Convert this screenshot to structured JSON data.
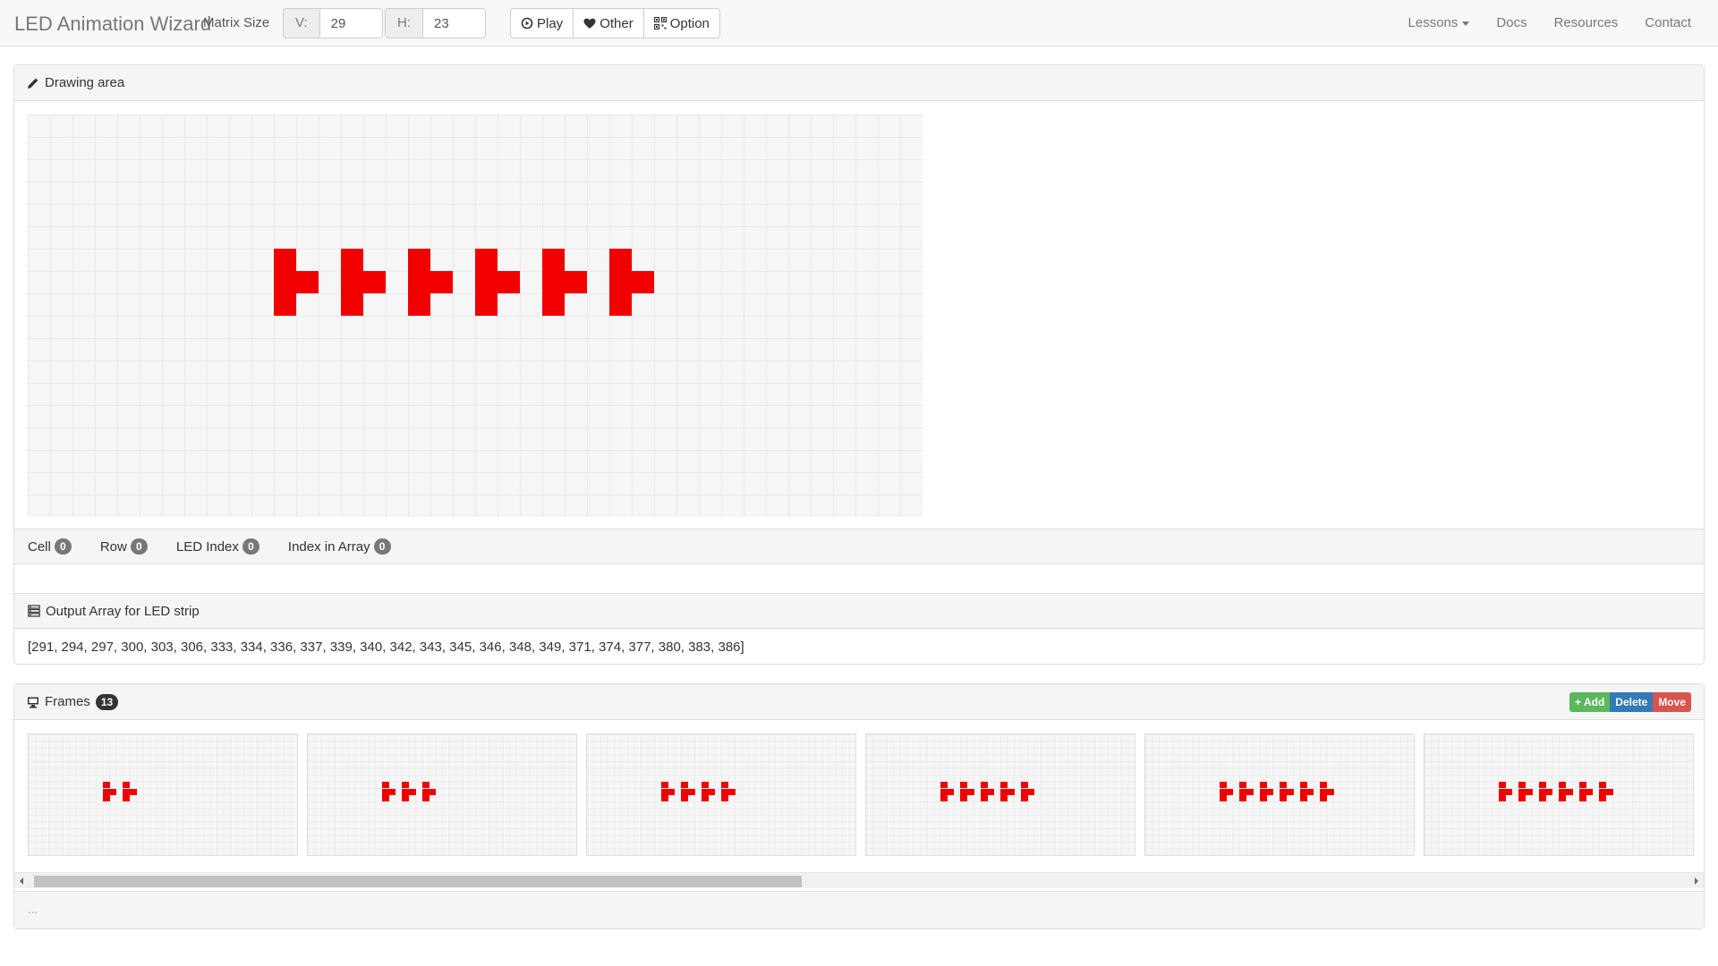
{
  "navbar": {
    "brand": "LED Animation Wizard",
    "matrix_label": "Matrix Size",
    "v_label": "V:",
    "v_value": "29",
    "h_label": "H:",
    "h_value": "23",
    "play_label": "Play",
    "other_label": "Other",
    "option_label": "Option",
    "links": {
      "lessons": "Lessons",
      "docs": "Docs",
      "resources": "Resources",
      "contact": "Contact"
    }
  },
  "drawing": {
    "title": "Drawing area",
    "led_color": "#f20000"
  },
  "info": {
    "cell_label": "Cell",
    "cell_value": "0",
    "row_label": "Row",
    "row_value": "0",
    "led_index_label": "LED Index",
    "led_index_value": "0",
    "index_array_label": "Index in Array",
    "index_array_value": "0"
  },
  "output": {
    "title": "Output Array for LED strip",
    "array_text": "[291, 294, 297, 300, 303, 306, 333, 334, 336, 337, 339, 340, 342, 343, 345, 346, 348, 349, 371, 374, 377, 380, 383, 386]"
  },
  "frames": {
    "title": "Frames",
    "count": "13",
    "add_label": "+ Add",
    "delete_label": "Delete",
    "move_label": "Move",
    "thumbnails": [
      {
        "shapes": 2
      },
      {
        "shapes": 3
      },
      {
        "shapes": 4
      },
      {
        "shapes": 5
      },
      {
        "shapes": 6
      },
      {
        "shapes": 6
      }
    ],
    "footer": "..."
  }
}
